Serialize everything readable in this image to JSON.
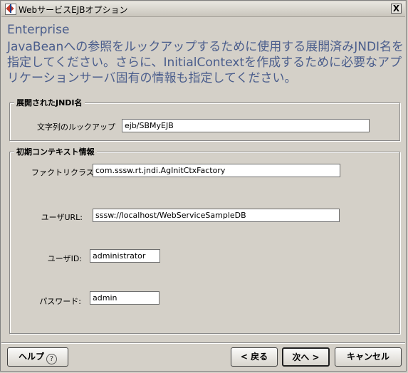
{
  "window": {
    "title": "WebサービスEJBオプション",
    "close_label": "X"
  },
  "header": {
    "title": "Enterprise",
    "description": "JavaBeanへの参照をルックアップするために使用する展開済みJNDI名を指定してください。さらに、InitialContextを作成するために必要なアプリケーションサーバ固有の情報も指定してください。"
  },
  "jndi_group": {
    "legend": "展開されたJNDI名",
    "lookup_label": "文字列のルックアップ",
    "lookup_value": "ejb/SBMyEJB"
  },
  "context_group": {
    "legend": "初期コンテキスト情報",
    "factory_label": "ファクトリクラス:",
    "factory_value": "com.sssw.rt.jndi.AgInitCtxFactory",
    "url_label": "ユーザURL:",
    "url_value": "sssw://localhost/WebServiceSampleDB",
    "user_label": "ユーザID:",
    "user_value": "administrator",
    "password_label": "パスワード:",
    "password_value": "admin"
  },
  "buttons": {
    "help": "ヘルプ",
    "help_icon": "?",
    "back": "< 戻る",
    "next": "次へ >",
    "cancel": "キャンセル"
  }
}
